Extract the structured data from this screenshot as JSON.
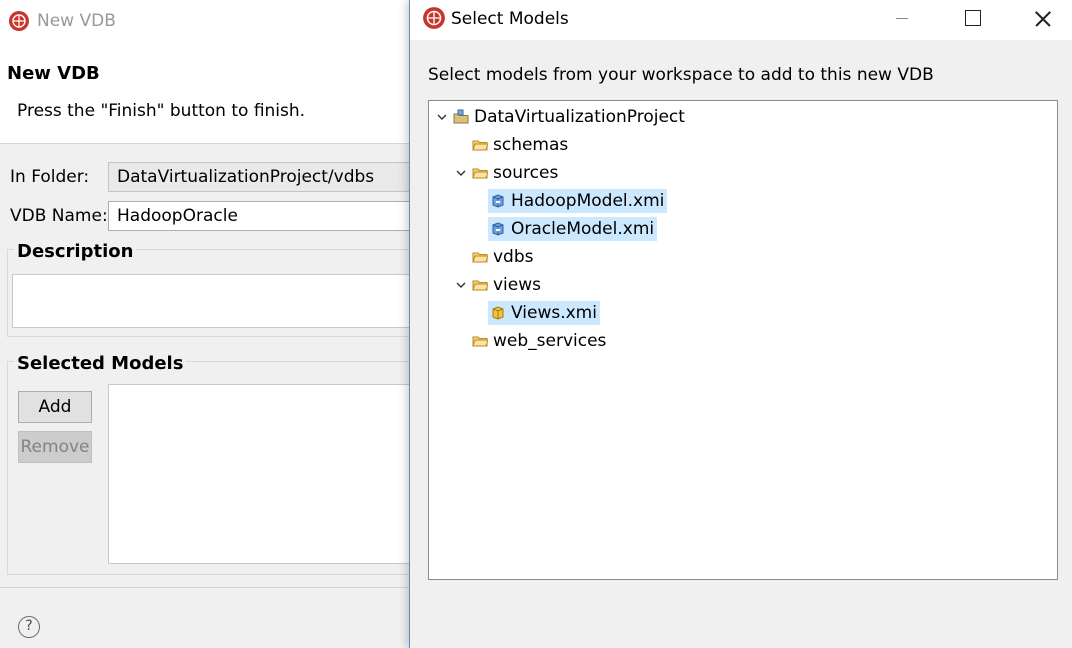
{
  "wizard": {
    "window_title": "New VDB",
    "heading": "New VDB",
    "message": "Press the \"Finish\" button to finish.",
    "folder_label": "In Folder:",
    "folder_value": "DataVirtualizationProject/vdbs",
    "name_label": "VDB Name:",
    "name_value": "HadoopOracle",
    "description_title": "Description",
    "description_value": "",
    "models_title": "Selected Models",
    "add_label": "Add",
    "remove_label": "Remove",
    "help_label": "?"
  },
  "dialog": {
    "window_title": "Select Models",
    "prompt": "Select models from your workspace to add to this new VDB",
    "tree": {
      "project": "DataVirtualizationProject",
      "schemas": "schemas",
      "sources": "sources",
      "hadoop_model": "HadoopModel.xmi",
      "oracle_model": "OracleModel.xmi",
      "vdbs": "vdbs",
      "views": "views",
      "views_model": "Views.xmi",
      "web_services": "web_services"
    }
  },
  "colors": {
    "selection": "#cce8ff",
    "dialog_border": "#5a8ecb",
    "folder": "#e8b84a",
    "source_model": "#3b7dd8",
    "view_model": "#e3b52b"
  }
}
